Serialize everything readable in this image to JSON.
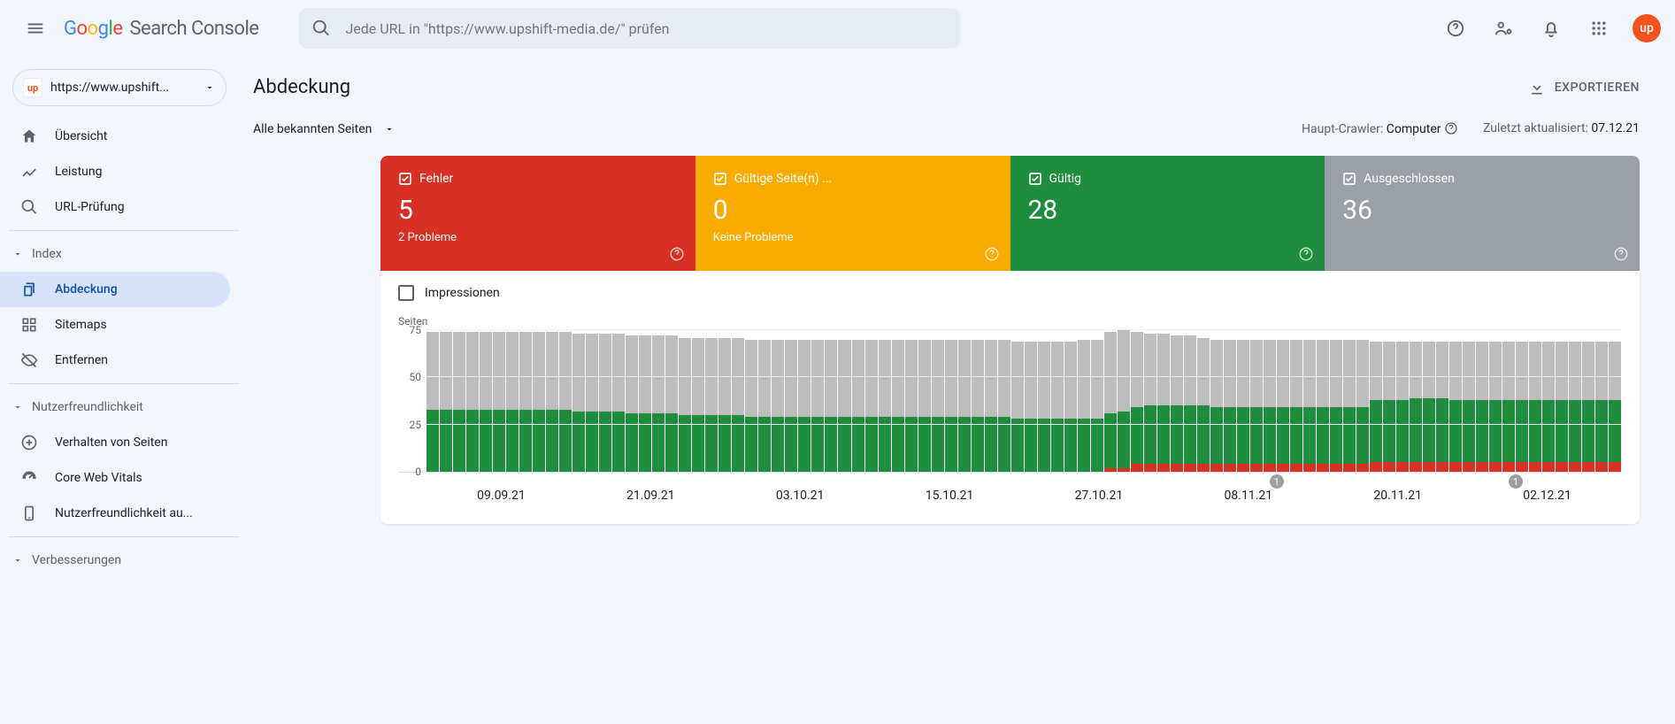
{
  "header": {
    "product": "Search Console",
    "search_placeholder": "Jede URL in \"https://www.upshift-media.de/\" prüfen",
    "avatar": "up"
  },
  "property": {
    "favicon": "up",
    "url": "https://www.upshift..."
  },
  "nav": {
    "main": [
      {
        "icon": "home",
        "label": "Übersicht"
      },
      {
        "icon": "trend",
        "label": "Leistung"
      },
      {
        "icon": "search",
        "label": "URL-Prüfung"
      }
    ],
    "index_label": "Index",
    "index": [
      {
        "icon": "copy",
        "label": "Abdeckung",
        "selected": true
      },
      {
        "icon": "sitemap",
        "label": "Sitemaps"
      },
      {
        "icon": "hide",
        "label": "Entfernen"
      }
    ],
    "ux_label": "Nutzerfreundlichkeit",
    "ux": [
      {
        "icon": "plus",
        "label": "Verhalten von Seiten"
      },
      {
        "icon": "speed",
        "label": "Core Web Vitals"
      },
      {
        "icon": "mobile",
        "label": "Nutzerfreundlichkeit au..."
      }
    ],
    "enh_label": "Verbesserungen"
  },
  "page": {
    "title": "Abdeckung",
    "export": "EXPORTIEREN",
    "filter": "Alle bekannten Seiten",
    "crawler_label": "Haupt-Crawler:",
    "crawler_value": "Computer",
    "updated_label": "Zuletzt aktualisiert:",
    "updated_value": "07.12.21"
  },
  "tabs": [
    {
      "color": "red",
      "label": "Fehler",
      "value": "5",
      "sub": "2 Probleme"
    },
    {
      "color": "yellow",
      "label": "Gültige Seite(n) ...",
      "value": "0",
      "sub": "Keine Probleme"
    },
    {
      "color": "green",
      "label": "Gültig",
      "value": "28",
      "sub": ""
    },
    {
      "color": "grey",
      "label": "Ausgeschlossen",
      "value": "36",
      "sub": ""
    }
  ],
  "impressions_label": "Impressionen",
  "chart_data": {
    "type": "bar",
    "ylabel": "Seiten",
    "ylim": [
      0,
      75
    ],
    "yticks": [
      0,
      25,
      50,
      75
    ],
    "categories": [
      "09.09.21",
      "21.09.21",
      "03.10.21",
      "15.10.21",
      "27.10.21",
      "08.11.21",
      "20.11.21",
      "02.12.21"
    ],
    "markers": [
      {
        "pos": 64,
        "label": "1"
      },
      {
        "pos": 82,
        "label": "1"
      },
      {
        "pos": 97,
        "label": "1"
      }
    ],
    "series": [
      {
        "name": "Fehler",
        "color": "#d93025",
        "values": [
          0,
          0,
          0,
          0,
          0,
          0,
          0,
          0,
          0,
          0,
          0,
          0,
          0,
          0,
          0,
          0,
          0,
          0,
          0,
          0,
          0,
          0,
          0,
          0,
          0,
          0,
          0,
          0,
          0,
          0,
          0,
          0,
          0,
          0,
          0,
          0,
          0,
          0,
          0,
          0,
          0,
          0,
          0,
          0,
          0,
          0,
          0,
          0,
          0,
          0,
          0,
          2,
          2,
          4,
          4,
          4,
          4,
          4,
          4,
          4,
          4,
          4,
          4,
          4,
          4,
          4,
          4,
          4,
          4,
          4,
          4,
          5,
          5,
          5,
          5,
          5,
          5,
          5,
          5,
          5,
          5,
          5,
          5,
          5,
          5,
          5,
          5,
          5,
          5,
          5
        ]
      },
      {
        "name": "Gültig",
        "color": "#1e8e3e",
        "values": [
          33,
          33,
          33,
          33,
          33,
          33,
          33,
          33,
          33,
          33,
          33,
          32,
          32,
          32,
          32,
          31,
          31,
          31,
          31,
          30,
          30,
          30,
          30,
          30,
          29,
          29,
          29,
          29,
          29,
          29,
          29,
          29,
          29,
          29,
          29,
          29,
          29,
          29,
          29,
          29,
          29,
          29,
          29,
          29,
          28,
          28,
          28,
          28,
          28,
          28,
          28,
          29,
          30,
          30,
          31,
          31,
          31,
          31,
          31,
          30,
          30,
          30,
          30,
          30,
          30,
          30,
          30,
          30,
          30,
          30,
          30,
          33,
          33,
          33,
          34,
          34,
          34,
          33,
          33,
          33,
          33,
          33,
          33,
          33,
          33,
          33,
          33,
          33,
          33,
          33
        ]
      },
      {
        "name": "Ausgeschlossen",
        "color": "#bdbdbd",
        "values": [
          41,
          41,
          41,
          41,
          41,
          41,
          41,
          41,
          41,
          41,
          41,
          41,
          41,
          41,
          41,
          41,
          41,
          41,
          41,
          41,
          41,
          41,
          41,
          41,
          41,
          41,
          41,
          41,
          41,
          41,
          41,
          41,
          41,
          41,
          41,
          41,
          41,
          41,
          41,
          41,
          41,
          41,
          41,
          41,
          41,
          41,
          41,
          41,
          41,
          42,
          42,
          43,
          43,
          40,
          38,
          38,
          37,
          37,
          36,
          36,
          36,
          36,
          36,
          36,
          36,
          36,
          36,
          36,
          36,
          36,
          36,
          31,
          31,
          31,
          30,
          30,
          30,
          31,
          31,
          31,
          31,
          31,
          31,
          31,
          31,
          31,
          31,
          31,
          31,
          31
        ]
      }
    ]
  }
}
